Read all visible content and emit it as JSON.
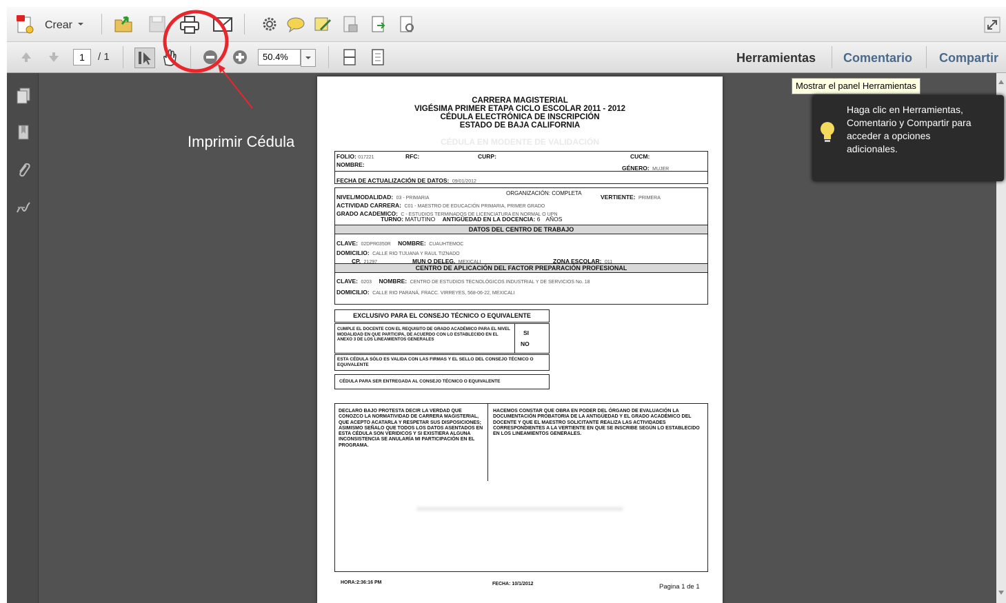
{
  "toolbar_top": {
    "create_label": "Crear"
  },
  "toolbar_nav": {
    "page_current": "1",
    "page_total": "/ 1",
    "zoom_value": "50.4%"
  },
  "right_tabs": {
    "tools": "Herramientas",
    "comment": "Comentario",
    "share": "Compartir"
  },
  "tooltip": {
    "text": "Mostrar el panel Herramientas"
  },
  "info_panel": {
    "lines": [
      "Haga clic en Herramientas,",
      "Comentario y Compartir para",
      "acceder a opciones",
      "adicionales."
    ]
  },
  "annotation": {
    "label": "Imprimir Cédula",
    "color": "#e8262b"
  },
  "document": {
    "header": [
      "CARRERA MAGISTERIAL",
      "VIGÉSIMA PRIMER ETAPA CICLO ESCOLAR 2011 - 2012",
      "CÉDULA ELECTRÓNICA DE INSCRIPCIÓN",
      "ESTADO DE BAJA CALIFORNIA"
    ],
    "watermark": "CÉDULA EN MODENTE DE VALIDACIÓN",
    "folio_label": "FOLIO:",
    "folio_value": "017221",
    "rfc_label": "RFC:",
    "curp_label": "CURP:",
    "cucm_label": "CUCM:",
    "nombre_label": "NOMBRE:",
    "genero_label": "GÉNERO:",
    "genero_value": "MUJER",
    "fecha_act_label": "FECHA DE ACTUALIZACIÓN DE DATOS:",
    "fecha_act_value": "09/01/2012",
    "nivel_label": "NIVEL/MODALIDAD:",
    "nivel_value": "03 - PRIMARIA",
    "organizacion": "ORGANIZACIÓN: COMPLETA",
    "vertiente_label": "VERTIENTE:",
    "vertiente_value": "PRIMERA",
    "actividad_label": "ACTIVIDAD CARRERA:",
    "actividad_value": "C01 - MAESTRO DE EDUCACIÓN PRIMARIA, PRIMER GRADO",
    "grado_label": "GRADO ACADEMICO:",
    "grado_value": "C - ESTUDIOS TERMINADOS DE LICENCIATURA EN NORMAL O UPN",
    "turno_label": "TURNO:",
    "turno_value": "MATUTINO",
    "antig_label": "ANTIGÜEDAD EN LA DOCENCIA:",
    "antig_value": "6",
    "antig_unit": "AÑOS",
    "datos_centro": "DATOS DEL CENTRO DE TRABAJO",
    "clave_label": "CLAVE:",
    "clave_value": "02DPR0350R",
    "nombre2_label": "NOMBRE:",
    "nombre2_value": "CUAUHTEMOC",
    "domicilio_label": "DOMICILIO:",
    "domicilio_value": "CALLE RIO TIJUANA Y RAUL TIZNADO",
    "cp_label": "CP.",
    "cp_value": "21297",
    "mun_label": "MUN O DELEG.",
    "mun_value": "MEXICALI",
    "zona_label": "ZONA ESCOLAR:",
    "zona_value": "011",
    "centro_aplic": "CENTRO DE APLICACIÓN DEL FACTOR PREPARACIÓN PROFESIONAL",
    "clave2_value": "0203",
    "nombre3_value": "CENTRO DE ESTUDIOS TECNOLÓGICOS INDUSTRIAL Y DE SERVICIOS No. 18",
    "domicilio2_value": "CALLE RIO PARANÁ, FRACC. VIRREYES, 568-06-22, MEXICALI",
    "consejo_title": "EXCLUSIVO PARA EL CONSEJO TÉCNICO O EQUIVALENTE",
    "consejo_text1": "CUMPLE EL DOCENTE CON EL REQUISITO DE GRADO ACADÉMICO PARA EL NIVEL MODALIDAD EN QUE PARTICIPA, DE ACUERDO CON LO ESTABLECIDO EN EL ANEXO 3 DE LOS LINEAMIENTOS GENERALES",
    "si": "SI",
    "no": "NO",
    "consejo_text2": "ESTA CÉDULA SÓLO ES VALIDA CON LAS FIRMAS Y EL SELLO DEL CONSEJO TÉCNICO O EQUIVALENTE",
    "consejo_text3": "CÉDULA PARA SER ENTREGADA AL CONSEJO TÉCNICO O EQUIVALENTE",
    "declaro": "DECLARO BAJO PROTESTA DECIR LA VERDAD QUE CONOZCO LA NORMATIVIDAD DE CARRERA MAGISTERIAL, QUE ACEPTO ACATARLA Y RESPETAR SUS DISPOSICIONES; ASIMISMO SEÑALO QUE TODOS LOS DATOS ASENTADOS EN ESTA CÉDULA SON VERIDICOS Y SI EXISTIERA ALGUNA INCONSISTENCIA SE ANULARÍA MI PARTICIPACIÓN EN EL PROGRAMA.",
    "hacemos": "HACEMOS CONSTAR QUE OBRA EN PODER DEL ÓRGANO DE EVALUACIÓN LA DOCUMENTACIÓN PROBATORIA DE LA ANTIGÜEDAD Y EL GRADO ACADÉMICO DEL DOCENTE Y QUE EL MAESTRO SOLICITANTE REALIZA LAS ACTIVIDADES CORRESPONDIENTES A LA VERTIENTE EN QUE SE INSCRIBE SEGÚN LO ESTABLECIDO EN LOS LINEAMIENTOS GENERALES.",
    "hora": "HORA:2:36:16 PM",
    "fecha": "FECHA: 10/1/2012",
    "pagina": "Pagina 1 de 1"
  }
}
